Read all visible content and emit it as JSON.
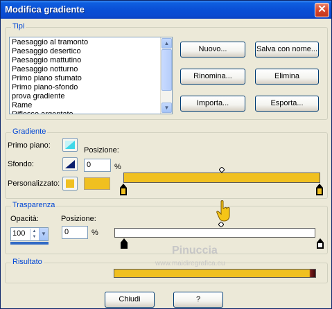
{
  "window": {
    "title": "Modifica gradiente",
    "close_label": "✕"
  },
  "tipi": {
    "label": "Tipi",
    "items": [
      "Paesaggio al tramonto",
      "Paesaggio desertico",
      "Paesaggio mattutino",
      "Paesaggio notturno",
      "Primo piano sfumato",
      "Primo piano-sfondo",
      "prova gradiente",
      "Rame",
      "Riflesso argentato"
    ],
    "buttons": {
      "new": "Nuovo...",
      "save_as": "Salva con nome...",
      "rename": "Rinomina...",
      "delete": "Elimina",
      "import": "Importa...",
      "export": "Esporta..."
    }
  },
  "gradiente": {
    "label": "Gradiente",
    "foreground_label": "Primo piano:",
    "background_label": "Sfondo:",
    "custom_label": "Personalizzato:",
    "position_label": "Posizione:",
    "position_value": "0",
    "percent": "%",
    "custom_color": "#f0c020",
    "bar_color": "#f0c020"
  },
  "trasparenza": {
    "label": "Trasparenza",
    "opacity_label": "Opacità:",
    "opacity_value": "100",
    "position_label": "Posizione:",
    "position_value": "0",
    "percent": "%"
  },
  "risultato": {
    "label": "Risultato",
    "bar_color": "#f0c020"
  },
  "footer": {
    "close": "Chiudi",
    "help": "?"
  },
  "watermark": {
    "name": "Pinuccia",
    "url": "www.maidiregrafica.eu"
  }
}
